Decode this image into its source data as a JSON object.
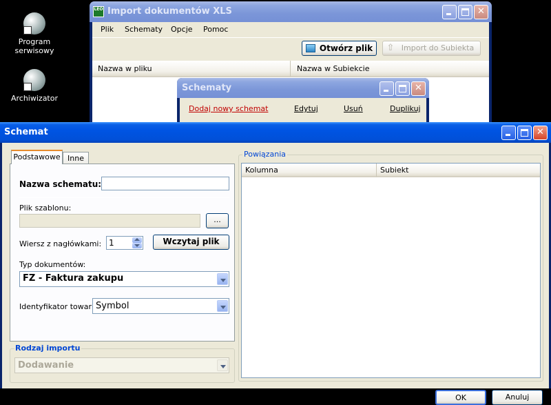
{
  "desktop": {
    "icons": [
      {
        "label_line1": "Program",
        "label_line2": "serwisowy"
      },
      {
        "label_line1": "Archiwizator",
        "label_line2": ""
      }
    ]
  },
  "import_window": {
    "title": "Import dokumentów XLS",
    "app_badge": "LEO",
    "menu": [
      "Plik",
      "Schematy",
      "Opcje",
      "Pomoc"
    ],
    "open_file_label": "Otwórz plik",
    "import_label": "Import do Subiekta",
    "columns": [
      "Nazwa w pliku",
      "Nazwa w Subiekcie"
    ]
  },
  "schematy_window": {
    "title": "Schematy",
    "links": {
      "add": "Dodaj nowy schemat",
      "edit": "Edytuj",
      "delete": "Usuń",
      "duplicate": "Duplikuj"
    }
  },
  "schemat_dialog": {
    "title": "Schemat",
    "tabs": [
      "Podstawowe",
      "Inne"
    ],
    "scheme_name_label": "Nazwa schematu:",
    "scheme_name_value": "",
    "template_file_label": "Plik szablonu:",
    "template_file_value": "",
    "browse_label": "...",
    "header_row_label": "Wiersz z nagłówkami:",
    "header_row_value": "1",
    "load_file_label": "Wczytaj plik",
    "doc_type_label": "Typ dokumentów:",
    "doc_type_value": "FZ - Faktura zakupu",
    "item_id_label": "Identyfikator towaru:",
    "item_id_value": "Symbol",
    "import_kind_label": "Rodzaj importu",
    "import_kind_value": "Dodawanie",
    "relations_label": "Powiązania",
    "relations_columns": [
      "Kolumna",
      "Subiekt"
    ],
    "ok_label": "OK",
    "cancel_label": "Anuluj"
  }
}
